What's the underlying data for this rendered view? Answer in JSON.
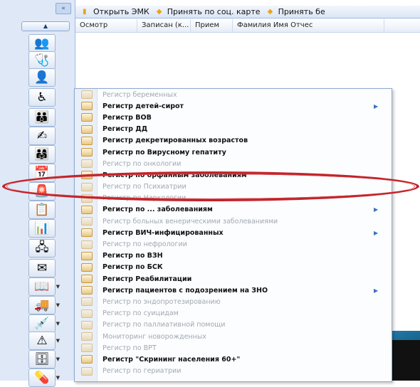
{
  "sidebar": {
    "collapse_label": "«",
    "scroll_up_label": "▲",
    "tools": [
      {
        "icon": "patients-icon",
        "glyph": "👥"
      },
      {
        "icon": "medical-kit-icon",
        "glyph": "🩺"
      },
      {
        "icon": "user-icon",
        "glyph": "👤"
      },
      {
        "icon": "wheelchair-icon",
        "glyph": "♿"
      },
      {
        "icon": "family-icon",
        "glyph": "👪"
      },
      {
        "icon": "document-pen-icon",
        "glyph": "✍"
      },
      {
        "icon": "people-group-icon",
        "glyph": "👨‍👩‍👧"
      },
      {
        "icon": "calendar-icon",
        "glyph": "📅"
      },
      {
        "icon": "alarm-light-icon",
        "glyph": "🚨"
      },
      {
        "icon": "report-icon",
        "glyph": "📋"
      },
      {
        "icon": "chart-edit-icon",
        "glyph": "📊"
      },
      {
        "icon": "hierarchy-icon",
        "glyph": "🖧"
      },
      {
        "icon": "envelope-icon",
        "glyph": "✉"
      },
      {
        "icon": "book-icon",
        "glyph": "📖"
      },
      {
        "icon": "truck-icon",
        "glyph": "🚚"
      },
      {
        "icon": "syringe-icon",
        "glyph": "💉"
      },
      {
        "icon": "warning-eye-icon",
        "glyph": "⚠"
      },
      {
        "icon": "registry-cabinet-icon",
        "glyph": "🗄"
      },
      {
        "icon": "medicine-icon",
        "glyph": "💊"
      }
    ]
  },
  "toolbar": {
    "open_emk": "Открыть ЭМК",
    "accept_card": "Принять по соц. карте",
    "accept_without": "Принять бе"
  },
  "grid": {
    "columns": [
      "Осмотр",
      "Записан (к...",
      "Прием",
      "Фамилия Имя Отчес"
    ]
  },
  "menu": {
    "items": [
      {
        "label": "Регистр беременных",
        "enabled": false,
        "submenu": false
      },
      {
        "label": "Регистр детей-сирот",
        "enabled": true,
        "submenu": true
      },
      {
        "label": "Регистр ВОВ",
        "enabled": true,
        "submenu": false
      },
      {
        "label": "Регистр ДД",
        "enabled": true,
        "submenu": false
      },
      {
        "label": "Регистр декретированных возрастов",
        "enabled": true,
        "submenu": false
      },
      {
        "label": "Регистр по Вирусному гепатиту",
        "enabled": true,
        "submenu": false
      },
      {
        "label": "Регистр по онкологии",
        "enabled": false,
        "submenu": false
      },
      {
        "label": "Регистр по орфанным заболеваниям",
        "enabled": true,
        "submenu": false
      },
      {
        "label": "Регистр по Психиатрии",
        "enabled": false,
        "submenu": false
      },
      {
        "label": "Регистр по Наркологии",
        "enabled": false,
        "submenu": false
      },
      {
        "label": "Регистр по ... заболеваниям",
        "enabled": true,
        "submenu": true
      },
      {
        "label": "Регистр больных венерическими заболеваниями",
        "enabled": false,
        "submenu": false
      },
      {
        "label": "Регистр ВИЧ-инфицированных",
        "enabled": true,
        "submenu": true
      },
      {
        "label": "Регистр по нефрологии",
        "enabled": false,
        "submenu": false
      },
      {
        "label": "Регистр по ВЗН",
        "enabled": true,
        "submenu": false
      },
      {
        "label": "Регистр по БСК",
        "enabled": true,
        "submenu": false
      },
      {
        "label": "Регистр Реабилитации",
        "enabled": true,
        "submenu": false
      },
      {
        "label": "Регистр пациентов с подозрением на ЗНО",
        "enabled": true,
        "submenu": true
      },
      {
        "label": "Регистр по эндопротезированию",
        "enabled": false,
        "submenu": false
      },
      {
        "label": "Регистр по суицидам",
        "enabled": false,
        "submenu": false
      },
      {
        "label": "Регистр по паллиативной помощи",
        "enabled": false,
        "submenu": false
      },
      {
        "label": "Мониторинг новорожденных",
        "enabled": false,
        "submenu": false
      },
      {
        "label": "Регистр по ВРТ",
        "enabled": false,
        "submenu": false
      },
      {
        "label": "Регистр \"Скрининг населения 60+\"",
        "enabled": true,
        "submenu": false
      },
      {
        "label": "Регистр по гериатрии",
        "enabled": false,
        "submenu": false
      }
    ],
    "submenu_arrow": "▶"
  },
  "highlight": {
    "item_index": 7,
    "color": "#c0232a"
  }
}
